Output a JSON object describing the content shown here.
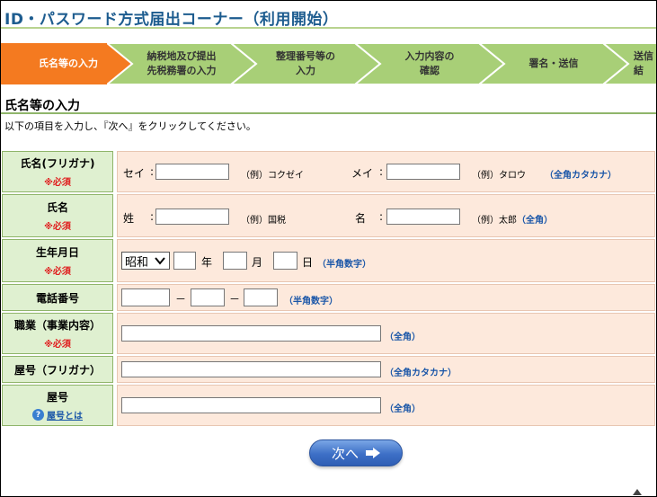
{
  "title": "ID・パスワード方式届出コーナー（利用開始）",
  "steps": [
    {
      "label": "氏名等の入力",
      "active": true
    },
    {
      "label": "納税地及び提出\n先税務署の入力",
      "active": false
    },
    {
      "label": "整理番号等の\n入力",
      "active": false
    },
    {
      "label": "入力内容の\n確認",
      "active": false
    },
    {
      "label": "署名・送信",
      "active": false
    },
    {
      "label": "送信\n結",
      "active": false
    }
  ],
  "colors": {
    "active_step": "#f47a20",
    "inactive_step": "#a8cf77",
    "accent": "#1a56a8"
  },
  "section_title": "氏名等の入力",
  "instruction": "以下の項目を入力し、『次へ』をクリックしてください。",
  "required_mark": "※必須",
  "rows": {
    "furigana": {
      "label": "氏名(フリガナ)",
      "sei_label": "セイ",
      "colon": ":",
      "sei_example": "（例）コクゼイ",
      "mei_label": "メイ",
      "mei_example": "（例）タロウ",
      "hint": "（全角カタカナ）"
    },
    "name": {
      "label": "氏名",
      "sei_label": "姓",
      "colon": ":",
      "sei_example": "（例）国税",
      "mei_label": "名",
      "mei_example": "（例）太郎",
      "hint": "（全角）"
    },
    "birth": {
      "label": "生年月日",
      "era": "昭和",
      "year": "年",
      "month": "月",
      "day": "日",
      "hint": "（半角数字）"
    },
    "phone": {
      "label": "電話番号",
      "dash": "－",
      "hint": "（半角数字）"
    },
    "occupation": {
      "label": "職業（事業内容）",
      "hint": "（全角）"
    },
    "trade_furigana": {
      "label": "屋号（フリガナ）",
      "hint": "（全角カタカナ）"
    },
    "trade": {
      "label": "屋号",
      "help": "屋号とは",
      "hint": "（全角）"
    }
  },
  "next_button": "次へ"
}
